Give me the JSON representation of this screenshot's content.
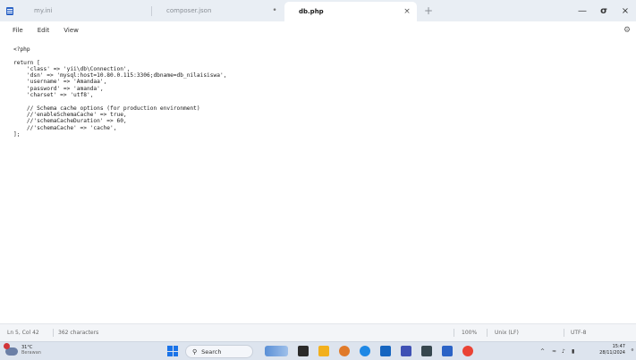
{
  "tabs": [
    {
      "label": "my.ini",
      "indicator": "",
      "active": false
    },
    {
      "label": "composer.json",
      "indicator": "•",
      "active": false
    },
    {
      "label": "db.php",
      "indicator": "×",
      "active": true
    }
  ],
  "new_tab": "+",
  "window": {
    "minimize": "—",
    "maximize": "σ",
    "close": "×"
  },
  "menu": {
    "file": "File",
    "edit": "Edit",
    "view": "View"
  },
  "settings_glyph": "⚙",
  "code": [
    "<?php",
    "",
    "return [",
    "    'class' => 'yii\\db\\Connection',",
    "    'dsn' => 'mysql:host=10.80.0.115:3306;dbname=db_nilaisiswa',",
    "    'username' => 'Amandaa',",
    "    'password' => 'amanda',",
    "    'charset' => 'utf8',",
    "",
    "    // Schema cache options (for production environment)",
    "    //'enableSchemaCache' => true,",
    "    //'schemaCacheDuration' => 60,",
    "    //'schemaCache' => 'cache',",
    "];"
  ],
  "status": {
    "position": "Ln 5, Col 42",
    "characters": "362 characters",
    "zoom": "100%",
    "line_ending": "Unix (LF)",
    "encoding": "UTF-8"
  },
  "taskbar": {
    "weather_temp": "31°C",
    "weather_condition": "Berawan",
    "search_label": "Search",
    "tray_chevron": "^",
    "time": "15:47",
    "date": "28/11/2024"
  },
  "colors": {
    "accent": "#1a73e8",
    "tab_bar": "#e9eef4",
    "taskbar": "#dde4ee"
  }
}
